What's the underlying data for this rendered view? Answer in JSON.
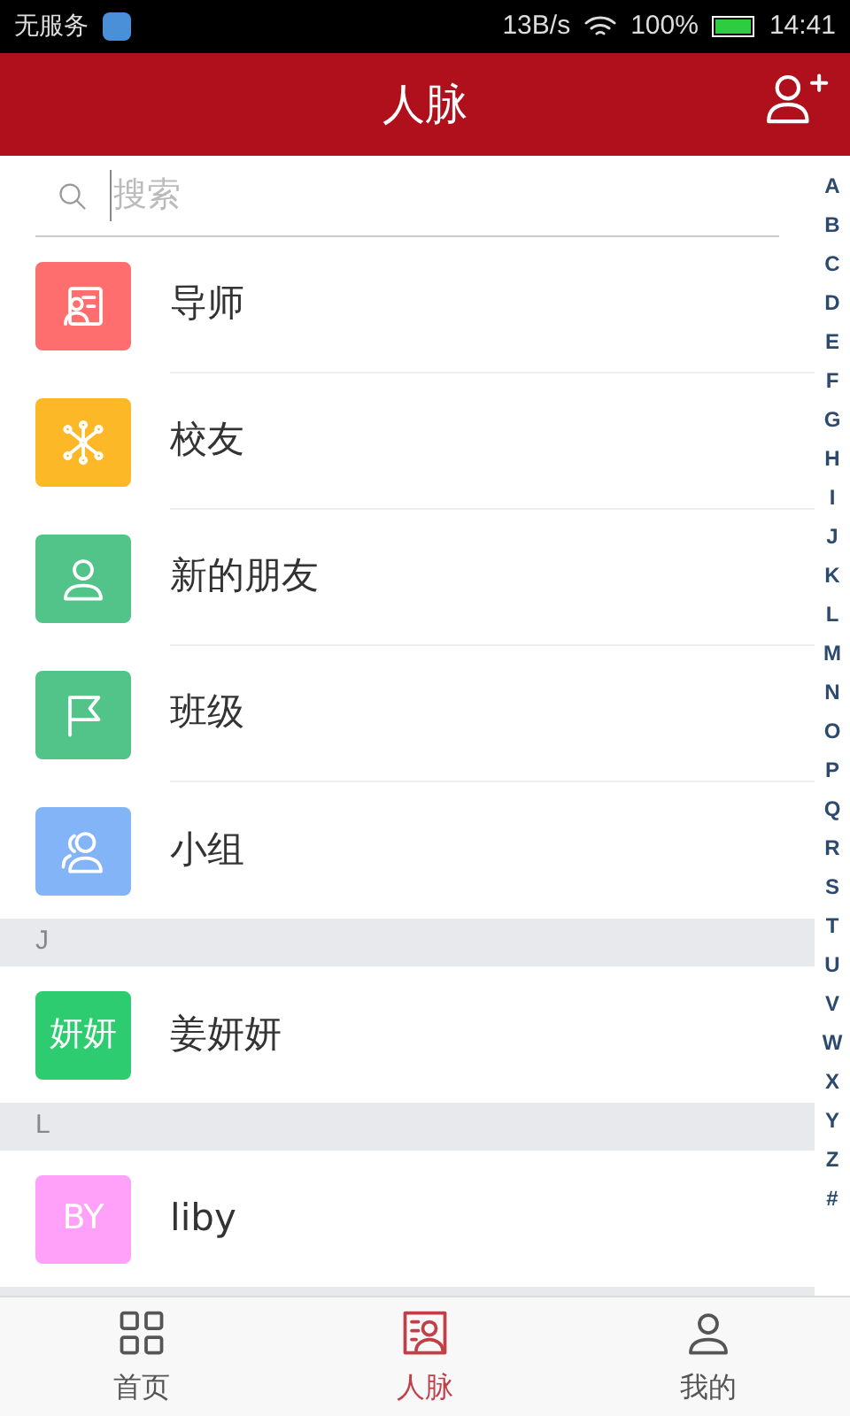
{
  "status_bar": {
    "carrier": "无服务",
    "speed": "13B/s",
    "battery": "100%",
    "time": "14:41"
  },
  "header": {
    "title": "人脉"
  },
  "search": {
    "placeholder": "搜索"
  },
  "sections": [
    {
      "items": [
        {
          "kind": "icon",
          "label": "导师",
          "color": "#ff6e6e"
        },
        {
          "kind": "icon",
          "label": "校友",
          "color": "#fdb827"
        },
        {
          "kind": "icon",
          "label": "新的朋友",
          "color": "#52c48a"
        },
        {
          "kind": "icon",
          "label": "班级",
          "color": "#52c48a"
        },
        {
          "kind": "icon",
          "label": "小组",
          "color": "#82b4f7"
        }
      ]
    },
    {
      "letter": "J",
      "items": [
        {
          "kind": "text",
          "avatar": "妍妍",
          "label": "姜妍妍",
          "color": "#2ecc71"
        }
      ]
    },
    {
      "letter": "L",
      "items": [
        {
          "kind": "text",
          "avatar": "BY",
          "label": "liby",
          "color": "#ffa1f9"
        }
      ]
    }
  ],
  "index": [
    "A",
    "B",
    "C",
    "D",
    "E",
    "F",
    "G",
    "H",
    "I",
    "J",
    "K",
    "L",
    "M",
    "N",
    "O",
    "P",
    "Q",
    "R",
    "S",
    "T",
    "U",
    "V",
    "W",
    "X",
    "Y",
    "Z",
    "#"
  ],
  "tabs": [
    {
      "label": "首页",
      "selected": false
    },
    {
      "label": "人脉",
      "selected": true
    },
    {
      "label": "我的",
      "selected": false
    }
  ]
}
